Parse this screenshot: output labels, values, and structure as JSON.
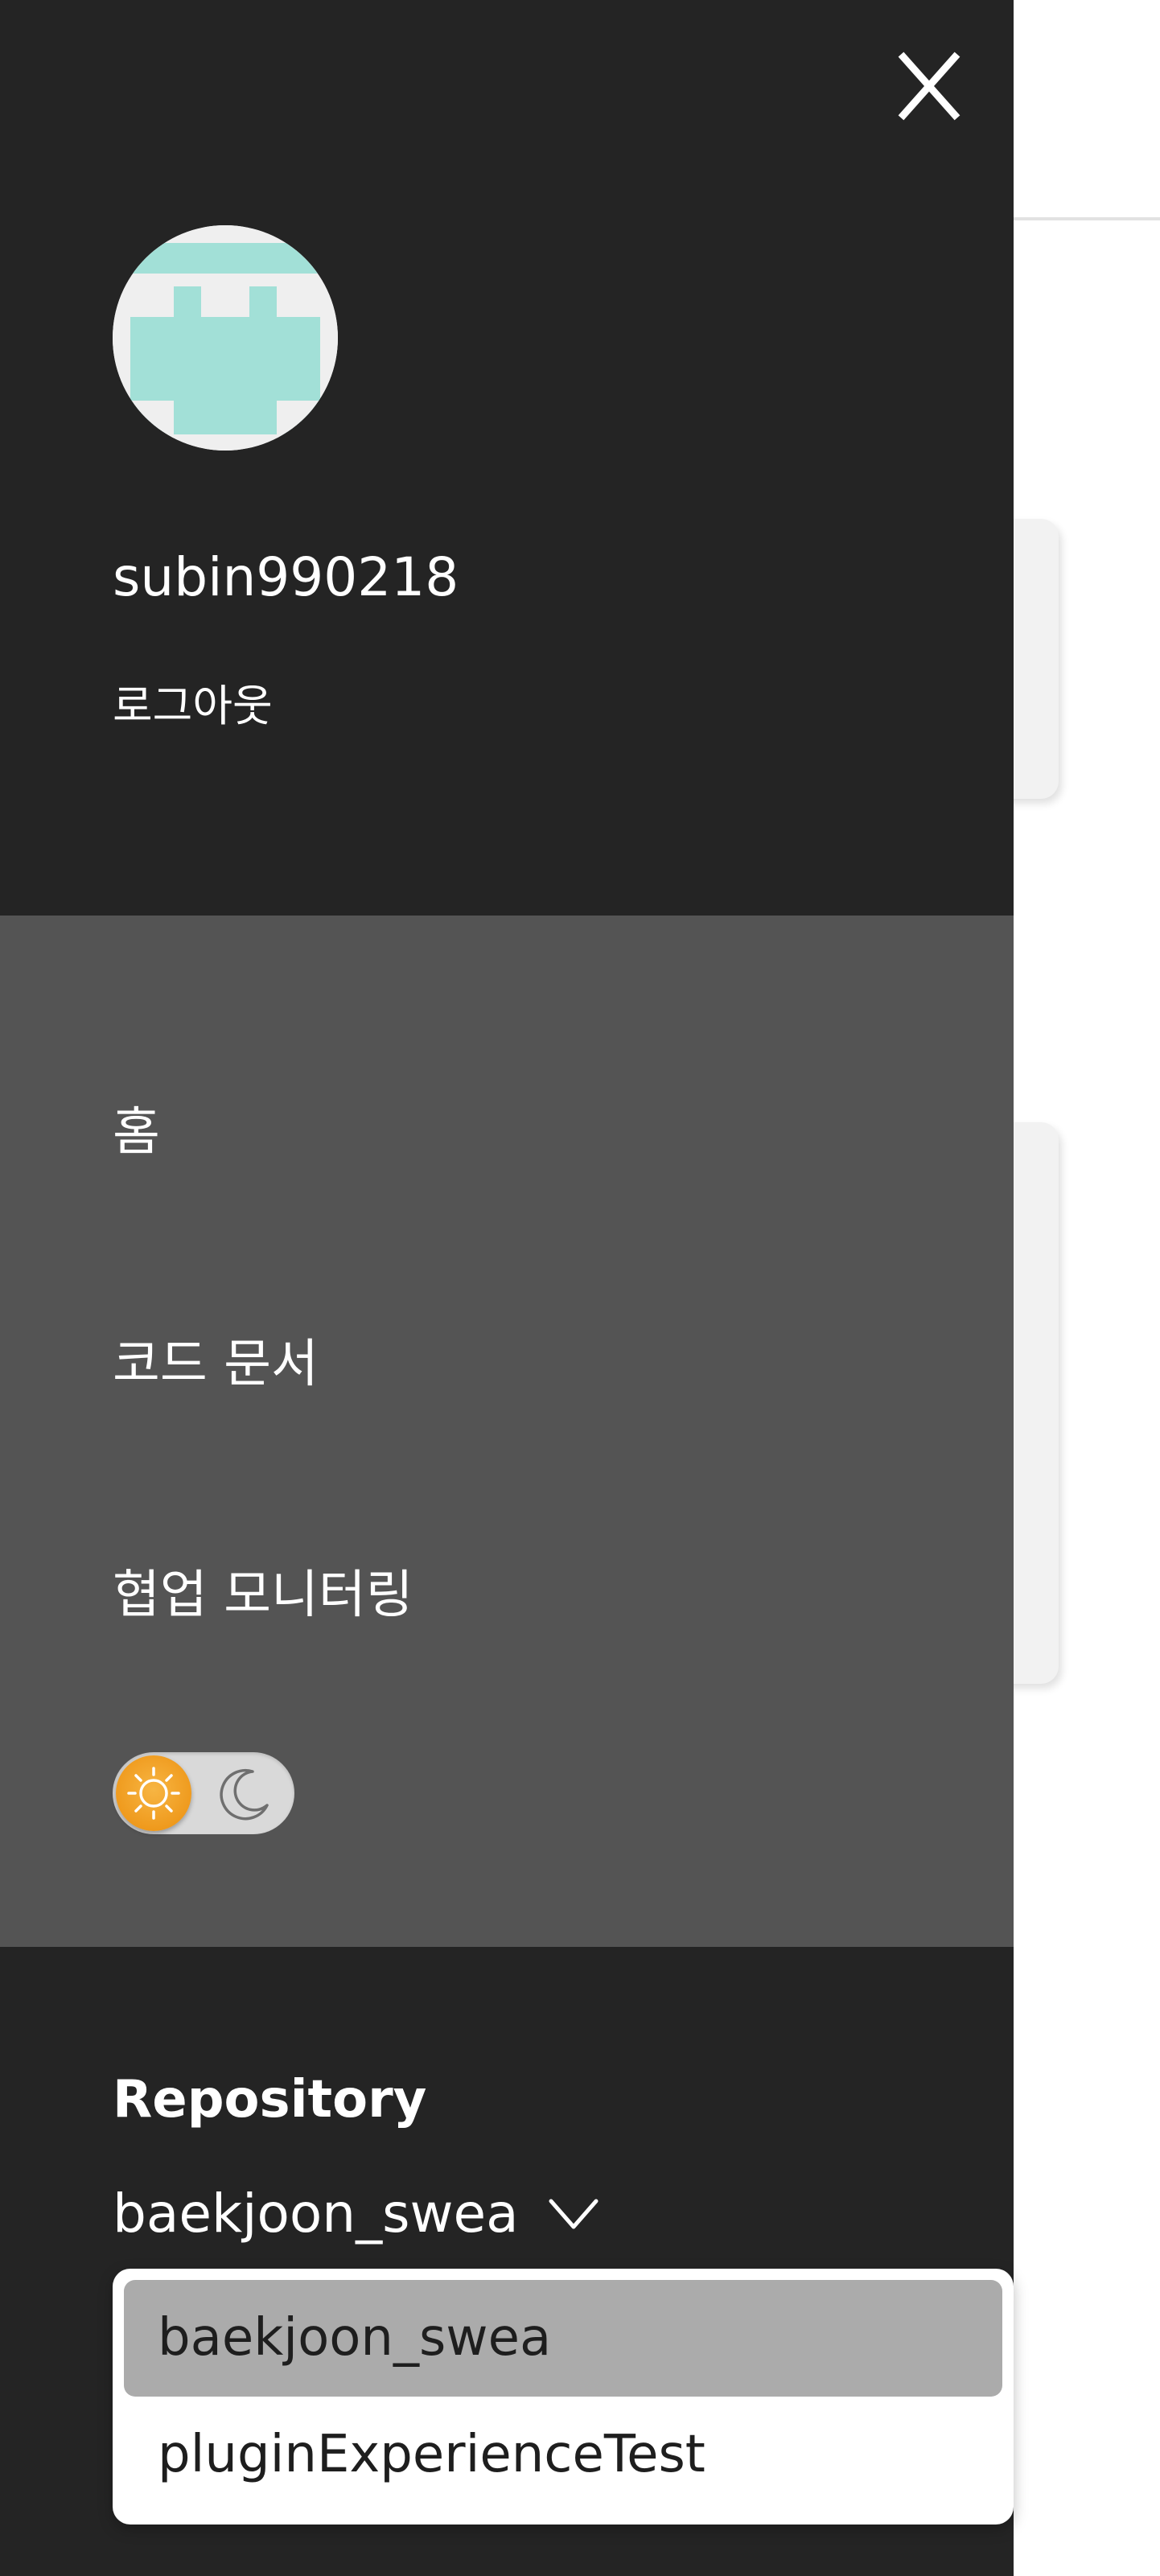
{
  "drawer": {
    "close_icon": "close-icon",
    "profile": {
      "avatar_icon": "identicon-avatar",
      "username": "subin990218",
      "logout_label": "로그아웃"
    },
    "nav": {
      "items": [
        {
          "label": "홈"
        },
        {
          "label": "코드 문서"
        },
        {
          "label": "협업 모니터링"
        }
      ],
      "theme_toggle": {
        "state": "light",
        "light_icon": "sun-icon",
        "dark_icon": "moon-icon"
      }
    },
    "repository": {
      "title": "Repository",
      "selected": "baekjoon_swea",
      "options": [
        {
          "label": "baekjoon_swea",
          "selected": true
        },
        {
          "label": "pluginExperienceTest",
          "selected": false
        }
      ]
    }
  },
  "colors": {
    "drawer_bg": "#242424",
    "nav_bg": "#545454",
    "avatar_accent": "#a2e0d7",
    "toggle_sun": "#ef9a1d",
    "option_selected_bg": "#ababab"
  }
}
